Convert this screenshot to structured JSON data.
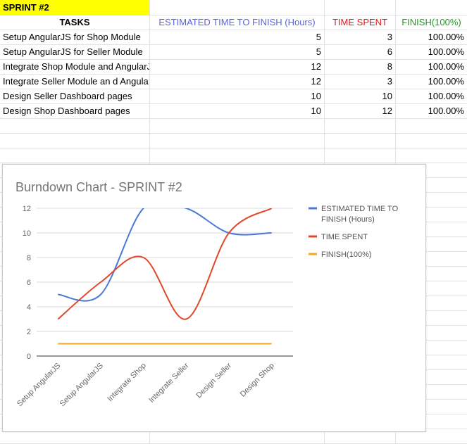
{
  "sheet": {
    "title": "SPRINT #2",
    "headers": {
      "tasks": "TASKS",
      "estimated": "ESTIMATED TIME TO FINISH (Hours)",
      "spent": "TIME SPENT",
      "finish": "FINISH(100%)"
    },
    "rows": [
      {
        "task": "Setup AngularJS for Shop Module",
        "estimated": "5",
        "spent": "3",
        "finish": "100.00%"
      },
      {
        "task": "Setup AngularJS for Seller Module",
        "estimated": "5",
        "spent": "6",
        "finish": "100.00%"
      },
      {
        "task": "Integrate Shop Module and AngularJ",
        "estimated": "12",
        "spent": "8",
        "finish": "100.00%"
      },
      {
        "task": "Integrate Seller Module an d Angula",
        "estimated": "12",
        "spent": "3",
        "finish": "100.00%"
      },
      {
        "task": "Design Seller Dashboard pages",
        "estimated": "10",
        "spent": "10",
        "finish": "100.00%"
      },
      {
        "task": "Design Shop Dashboard pages",
        "estimated": "10",
        "spent": "12",
        "finish": "100.00%"
      }
    ]
  },
  "chart_data": {
    "type": "line",
    "title": "Burndown Chart - SPRINT #2",
    "categories": [
      "Setup AngularJS",
      "Setup AngularJS",
      "Integrate Shop",
      "Integrate Seller",
      "Design Seller",
      "Design Shop"
    ],
    "series": [
      {
        "name": "ESTIMATED TIME TO FINISH (Hours)",
        "values": [
          5,
          5,
          12,
          12,
          10,
          10
        ],
        "color": "#4a78d6"
      },
      {
        "name": "TIME SPENT",
        "values": [
          3,
          6,
          8,
          3,
          10,
          12
        ],
        "color": "#e0482a"
      },
      {
        "name": "FINISH(100%)",
        "values": [
          1,
          1,
          1,
          1,
          1,
          1
        ],
        "color": "#f5a623"
      }
    ],
    "ylim": [
      0,
      12
    ],
    "yticks": [
      0,
      2,
      4,
      6,
      8,
      10,
      12
    ],
    "grid": true,
    "legend": "right",
    "smooth": true
  }
}
